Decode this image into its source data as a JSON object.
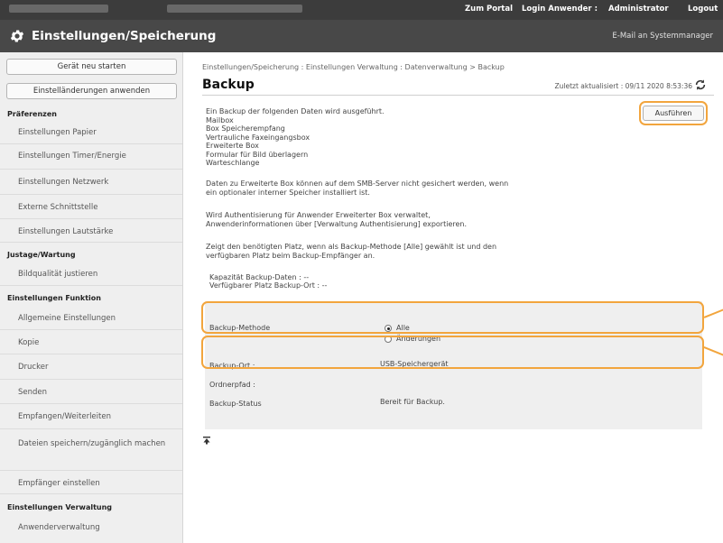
{
  "topbar": {
    "portal_link": "Zum Portal",
    "login_label": "Login Anwender :",
    "login_user": "Administrator",
    "logout_link": "Logout"
  },
  "header": {
    "title": "Einstellungen/Speicherung",
    "mail_link": "E-Mail an Systemmanager",
    "icon": "gear-icon"
  },
  "sidebar": {
    "restart_button": "Gerät neu starten",
    "apply_button": "Einstelländerungen anwenden",
    "sections": [
      {
        "title": "Präferenzen",
        "items": [
          "Einstellungen Papier",
          "Einstellungen Timer/Energie",
          "Einstellungen Netzwerk",
          "Externe Schnittstelle",
          "Einstellungen Lautstärke"
        ]
      },
      {
        "title": "Justage/Wartung",
        "items": [
          "Bildqualität justieren"
        ]
      },
      {
        "title": "Einstellungen Funktion",
        "items": [
          "Allgemeine Einstellungen",
          "Kopie",
          "Drucker",
          "Senden",
          "Empfangen/Weiterleiten",
          "Dateien speichern/zugänglich machen",
          "Empfänger einstellen"
        ]
      },
      {
        "title": "Einstellungen Verwaltung",
        "items": [
          "Anwenderverwaltung"
        ]
      }
    ]
  },
  "content": {
    "breadcrumb": "Einstellungen/Speicherung : Einstellungen Verwaltung : Datenverwaltung > Backup",
    "title": "Backup",
    "updated": "Zuletzt aktualisiert : 09/11 2020 8:53:36",
    "execute_button": "Ausführen",
    "intro": "Ein Backup der folgenden Daten wird ausgeführt.",
    "backup_items": [
      "Mailbox",
      "Box Speicherempfang",
      "Vertrauliche Faxeingangsbox",
      "Erweiterte Box",
      "Formular für Bild überlagern",
      "Warteschlange"
    ],
    "note1_line1": "Daten zu Erweiterte Box können auf dem SMB-Server nicht gesichert werden, wenn",
    "note1_line2": "ein optionaler interner Speicher installiert ist.",
    "note2_line1": "Wird Authentisierung für Anwender Erweiterter Box verwaltet,",
    "note2_line2": "Anwenderinformationen über [Verwaltung Authentisierung] exportieren.",
    "note3_line1": "Zeigt den benötigten Platz, wenn als Backup-Methode [Alle] gewählt ist und den",
    "note3_line2": "verfügbaren Platz beim Backup-Empfänger an.",
    "capacity_label": "Kapazität Backup-Daten : --",
    "available_label": "Verfügbarer Platz Backup-Ort : --",
    "method_label": "Backup-Methode",
    "method_options": [
      "Alle",
      "Änderungen"
    ],
    "method_selected": "Alle",
    "location_label": "Backup-Ort :",
    "location_value": "USB-Speichergerät",
    "folder_label": "Ordnerpfad :",
    "status_label": "Backup-Status",
    "status_value": "Bereit für Backup."
  },
  "colors": {
    "topbar": "#3c3c3c",
    "header": "#484848",
    "sidebar": "#efefef",
    "highlight": "#f2a53d"
  }
}
